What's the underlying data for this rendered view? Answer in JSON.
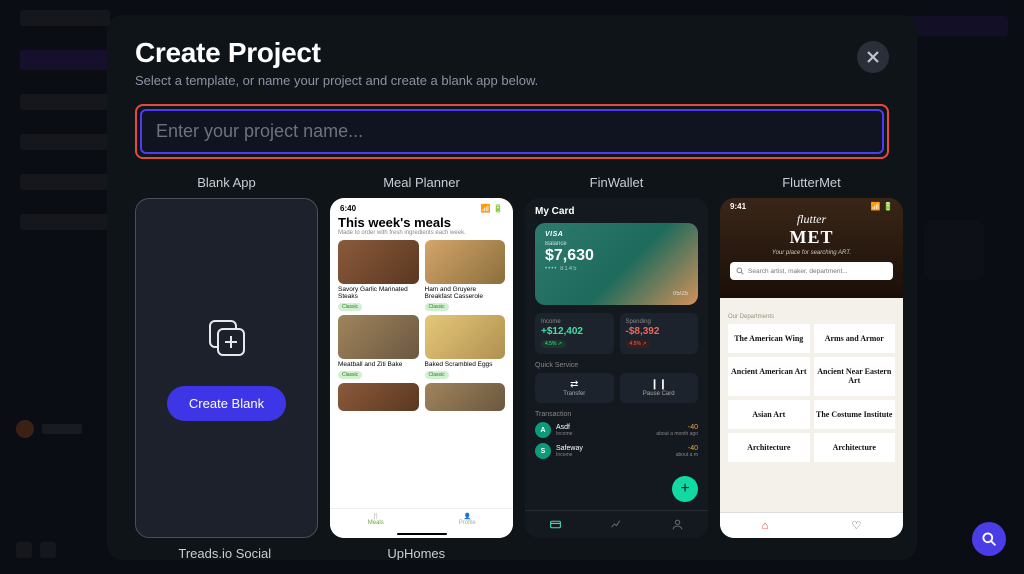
{
  "modal": {
    "title": "Create Project",
    "subtitle": "Select a template, or name your project and create a blank app below.",
    "input_placeholder": "Enter your project name..."
  },
  "templates": [
    {
      "label": "Blank App"
    },
    {
      "label": "Meal Planner"
    },
    {
      "label": "FinWallet"
    },
    {
      "label": "FlutterMet"
    }
  ],
  "row2": [
    {
      "label": "Treads.io Social"
    },
    {
      "label": "UpHomes"
    }
  ],
  "blank": {
    "button": "Create Blank"
  },
  "meal": {
    "time": "6:40",
    "heading": "This week's meals",
    "subheading": "Made to order with fresh ingredients each week.",
    "items": [
      {
        "name": "Savory Garlic Marinated Steaks",
        "tag": "Classic"
      },
      {
        "name": "Ham and Gruyere Breakfast Casserole",
        "tag": "Classic"
      },
      {
        "name": "Meatball and Ziti Bake",
        "tag": "Classic"
      },
      {
        "name": "Baked Scrambled Eggs",
        "tag": "Classic"
      }
    ],
    "nav": {
      "meals": "Meals",
      "profile": "Profile"
    }
  },
  "fin": {
    "title": "My Card",
    "card": {
      "brand": "VISA",
      "balance_label": "Balance",
      "balance": "$7,630",
      "last4": "•••• 8145",
      "expiry": "05/25"
    },
    "income": {
      "label": "Income",
      "value": "+$12,402",
      "pct": "4.5% ↗"
    },
    "spending": {
      "label": "Spending",
      "value": "-$8,392",
      "pct": "4.5% ↗"
    },
    "quick_label": "Quick Service",
    "quick": [
      {
        "icon": "⇄",
        "label": "Transfer"
      },
      {
        "icon": "❙❙",
        "label": "Pause Card"
      }
    ],
    "trans_label": "Transaction",
    "transactions": [
      {
        "initial": "A",
        "name": "Asdf",
        "cat": "Income",
        "amount": "-40",
        "when": "about a month ago"
      },
      {
        "initial": "S",
        "name": "Safeway",
        "cat": "Income",
        "amount": "-40",
        "when": "about a m"
      }
    ]
  },
  "met": {
    "time": "9:41",
    "logo_top": "flutter",
    "logo_main": "MET",
    "tagline": "Your place for searching ART.",
    "search_placeholder": "Search artist, maker, department...",
    "dept_label": "Our Departments",
    "departments": [
      "The American Wing",
      "Arms and Armor",
      "Ancient American Art",
      "Ancient Near Eastern Art",
      "Asian Art",
      "The Costume Institute",
      "Architecture",
      "Architecture"
    ]
  }
}
